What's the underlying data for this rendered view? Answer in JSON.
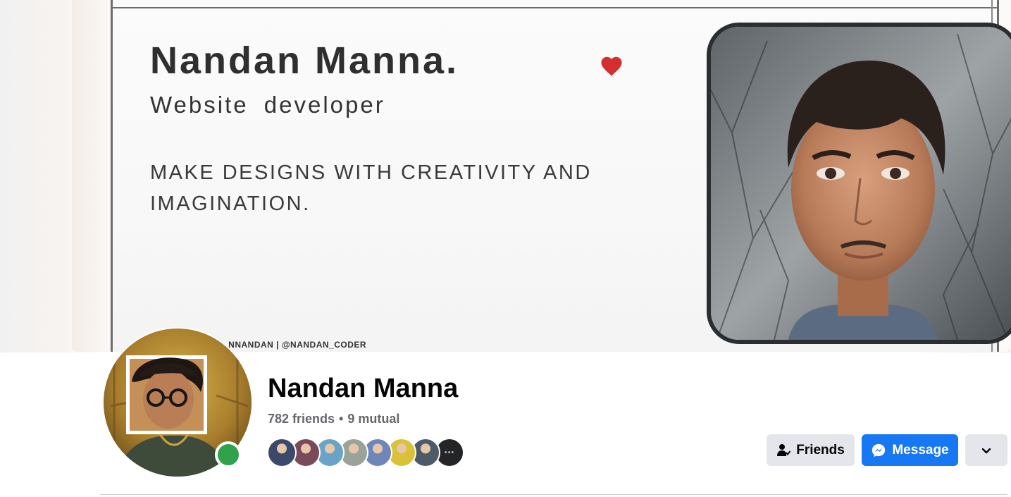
{
  "cover": {
    "name": "Nandan Manna.",
    "role": "Website  developer",
    "tagline": "MAKE DESIGNS WITH CREATIVITY AND IMAGINATION.",
    "handles": "TH_NNANDAN | @NANDAN_CODER",
    "heart_color": "#d32f2f"
  },
  "profile": {
    "name": "Nandan Manna",
    "friends_count": "782 friends",
    "separator": "•",
    "mutual_count": "9 mutual",
    "online": true
  },
  "mutual_friends": [
    {
      "name": "mutual-friend-1",
      "color": "#3b4a6b"
    },
    {
      "name": "mutual-friend-2",
      "color": "#7b4a5a"
    },
    {
      "name": "mutual-friend-3",
      "color": "#6aa3c8"
    },
    {
      "name": "mutual-friend-4",
      "color": "#9aa39a"
    },
    {
      "name": "mutual-friend-5",
      "color": "#6f86b8"
    },
    {
      "name": "mutual-friend-6",
      "color": "#d9c23a"
    },
    {
      "name": "mutual-friend-7",
      "color": "#4d5a68"
    },
    {
      "name": "more-mutual-friends",
      "color": "#242526",
      "icon": "more-dots-icon"
    }
  ],
  "actions": {
    "friends_label": "Friends",
    "message_label": "Message",
    "more_icon": "chevron-down-icon"
  },
  "colors": {
    "primary": "#1877f2",
    "secondary_button": "#e4e6eb",
    "online": "#31a24c",
    "muted_text": "#65676b"
  }
}
